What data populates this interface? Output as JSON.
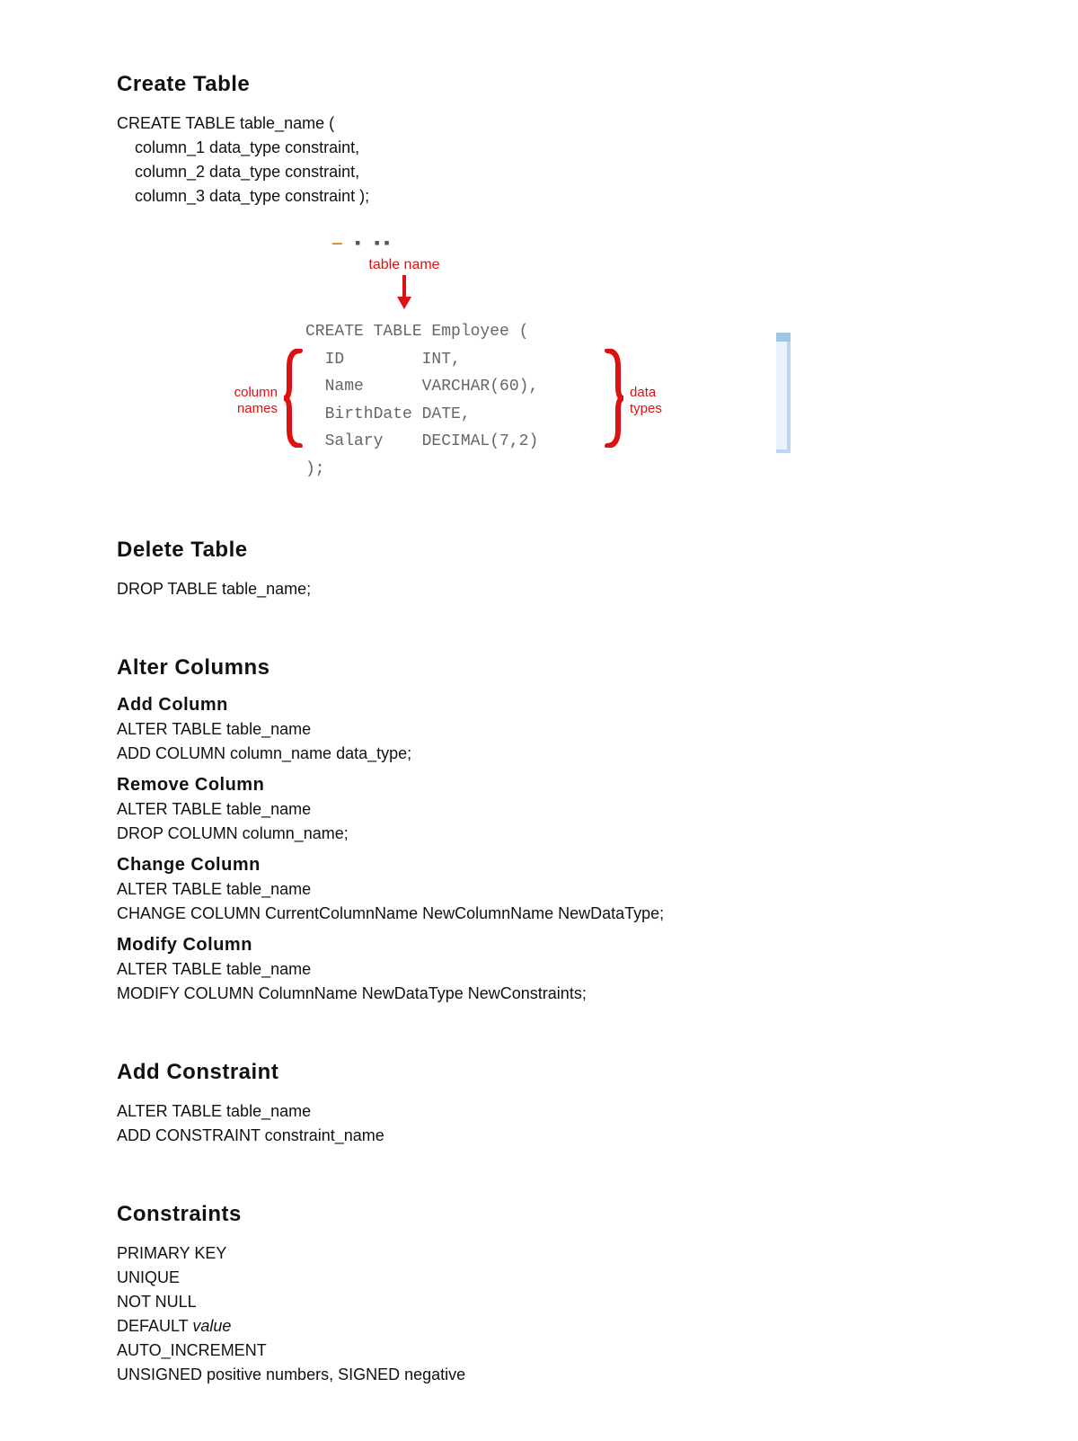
{
  "sections": {
    "create_table": {
      "title": "Create Table",
      "syntax": "CREATE TABLE table_name (\n    column_1 data_type constraint,\n    column_2 data_type constraint,\n    column_3 data_type constraint );"
    },
    "diagram": {
      "top_label": "table name",
      "left_label_line1": "column",
      "left_label_line2": "names",
      "right_label_line1": "data",
      "right_label_line2": "types",
      "code_lines": {
        "l0": "CREATE TABLE Employee (",
        "l1": "  ID        INT,",
        "l2": "  Name      VARCHAR(60),",
        "l3": "  BirthDate DATE,",
        "l4": "  Salary    DECIMAL(7,2)",
        "l5": ");"
      }
    },
    "delete_table": {
      "title": "Delete Table",
      "syntax": "DROP TABLE table_name;"
    },
    "alter_columns": {
      "title": "Alter Columns",
      "add": {
        "title": "Add Column",
        "body": "ALTER TABLE table_name\nADD COLUMN column_name data_type;"
      },
      "remove": {
        "title": "Remove Column",
        "body": "ALTER TABLE table_name\nDROP COLUMN column_name;"
      },
      "change": {
        "title": "Change Column",
        "body": "ALTER TABLE table_name\nCHANGE COLUMN CurrentColumnName NewColumnName NewDataType;"
      },
      "modify": {
        "title": "Modify Column",
        "body": "ALTER TABLE table_name\nMODIFY COLUMN ColumnName NewDataType NewConstraints;"
      }
    },
    "add_constraint": {
      "title": "Add Constraint",
      "body": "ALTER TABLE table_name\nADD CONSTRAINT constraint_name"
    },
    "constraints": {
      "title": "Constraints",
      "l0": "PRIMARY KEY",
      "l1": "UNIQUE",
      "l2": "NOT NULL",
      "l3a": "DEFAULT ",
      "l3b": "value",
      "l4": "AUTO_INCREMENT",
      "l5": "UNSIGNED positive numbers, SIGNED negative"
    }
  }
}
